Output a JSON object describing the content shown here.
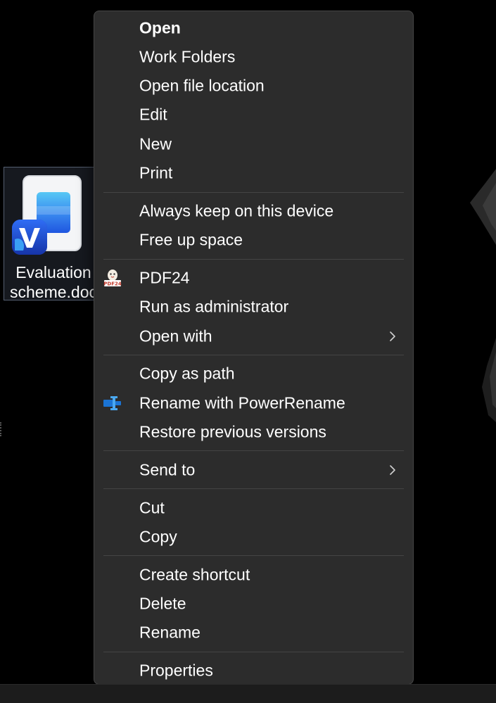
{
  "desktop": {
    "icon": {
      "label_line1": "Evaluation",
      "label_line2": "scheme.doc",
      "file_icon": "word-document-icon",
      "badge_icon": "app-badge-icon"
    }
  },
  "context_menu": {
    "groups": [
      [
        {
          "label": "Open",
          "bold": true
        },
        {
          "label": "Work Folders"
        },
        {
          "label": "Open file location"
        },
        {
          "label": "Edit"
        },
        {
          "label": "New"
        },
        {
          "label": "Print"
        }
      ],
      [
        {
          "label": "Always keep on this device"
        },
        {
          "label": "Free up space"
        }
      ],
      [
        {
          "label": "PDF24",
          "icon": "pdf24-icon"
        },
        {
          "label": "Run as administrator"
        },
        {
          "label": "Open with",
          "submenu": true
        }
      ],
      [
        {
          "label": "Copy as path"
        },
        {
          "label": "Rename with PowerRename",
          "icon": "powerrename-icon"
        },
        {
          "label": "Restore previous versions"
        }
      ],
      [
        {
          "label": "Send to",
          "submenu": true
        }
      ],
      [
        {
          "label": "Cut"
        },
        {
          "label": "Copy"
        }
      ],
      [
        {
          "label": "Create shortcut"
        },
        {
          "label": "Delete"
        },
        {
          "label": "Rename"
        }
      ],
      [
        {
          "label": "Properties"
        }
      ]
    ]
  },
  "colors": {
    "menu_background": "#2c2c2c",
    "menu_border": "#454545",
    "separator": "#444444",
    "text": "#ffffff",
    "desktop_background": "#000000",
    "accent_blue": "#1f55e0"
  }
}
